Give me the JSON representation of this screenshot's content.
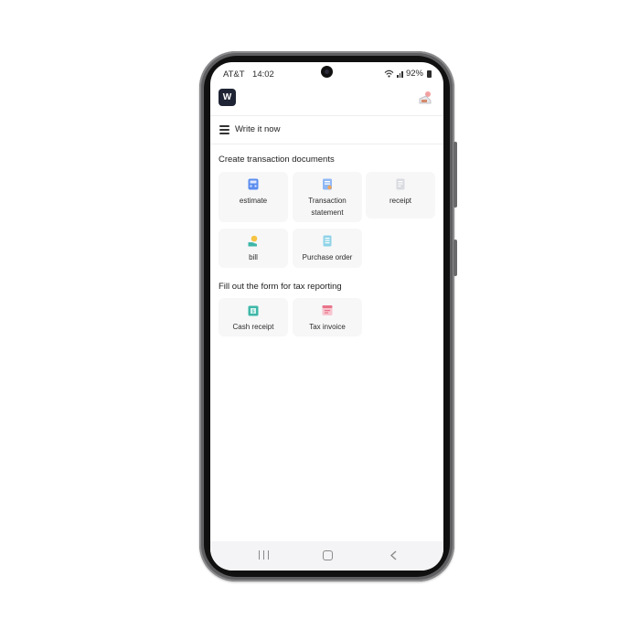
{
  "status_bar": {
    "carrier": "AT&T",
    "time": "14:02",
    "battery": "92%"
  },
  "app_bar": {
    "logo_letter": "W"
  },
  "menu": {
    "title": "Write it now"
  },
  "sections": [
    {
      "title": "Create transaction documents",
      "items": [
        {
          "label": "estimate",
          "icon": "calculator-icon"
        },
        {
          "label": "Transaction statement",
          "icon": "statement-icon"
        },
        {
          "label": "receipt",
          "icon": "receipt-icon"
        },
        {
          "label": "bill",
          "icon": "bill-icon"
        },
        {
          "label": "Purchase order",
          "icon": "purchase-order-icon"
        }
      ]
    },
    {
      "title": "Fill out the form for tax reporting",
      "items": [
        {
          "label": "Cash receipt",
          "icon": "cash-receipt-icon"
        },
        {
          "label": "Tax invoice",
          "icon": "tax-invoice-icon"
        }
      ]
    }
  ],
  "colors": {
    "card_bg": "#f7f7f8",
    "logo_bg": "#1e2434",
    "accent_blue": "#5b8def",
    "accent_teal": "#3fb7a8",
    "accent_pink": "#e8748a"
  }
}
